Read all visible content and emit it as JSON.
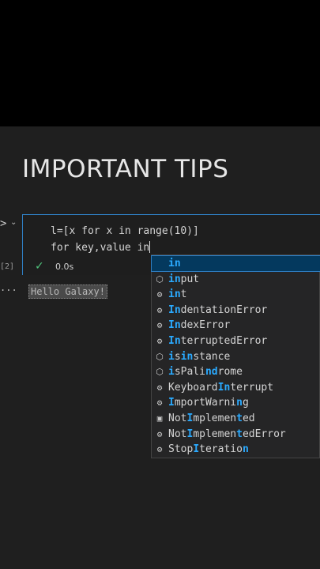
{
  "title": "IMPORTANT TIPS",
  "gutter": {
    "run_chevron": ">",
    "collapse_chevron": "⌄",
    "exec_count": "[2]",
    "ellipsis": "..."
  },
  "cell": {
    "code_line_1": "l=[x for x in range(10)]",
    "code_line_2": "for key,value in",
    "exec_status_icon": "check-icon",
    "exec_time": "0.0s",
    "output": "Hello Galaxy!"
  },
  "suggestions": {
    "items": [
      {
        "label": "in",
        "icon": "keyword-icon",
        "selected": true
      },
      {
        "label": "input",
        "icon": "function-icon"
      },
      {
        "label": "int",
        "icon": "class-icon"
      },
      {
        "label": "IndentationError",
        "icon": "class-icon"
      },
      {
        "label": "IndexError",
        "icon": "class-icon"
      },
      {
        "label": "InterruptedError",
        "icon": "class-icon"
      },
      {
        "label": "isinstance",
        "icon": "function-icon"
      },
      {
        "label": "isPalindrome",
        "icon": "function-icon"
      },
      {
        "label": "KeyboardInterrupt",
        "icon": "class-icon"
      },
      {
        "label": "ImportWarning",
        "icon": "class-icon"
      },
      {
        "label": "NotImplemented",
        "icon": "constant-icon"
      },
      {
        "label": "NotImplementedError",
        "icon": "class-icon"
      },
      {
        "label": "StopIteration",
        "icon": "class-icon"
      }
    ]
  },
  "colors": {
    "accent": "#2f7fc4",
    "match_highlight": "#2aaaff",
    "success": "#4ec07a"
  }
}
